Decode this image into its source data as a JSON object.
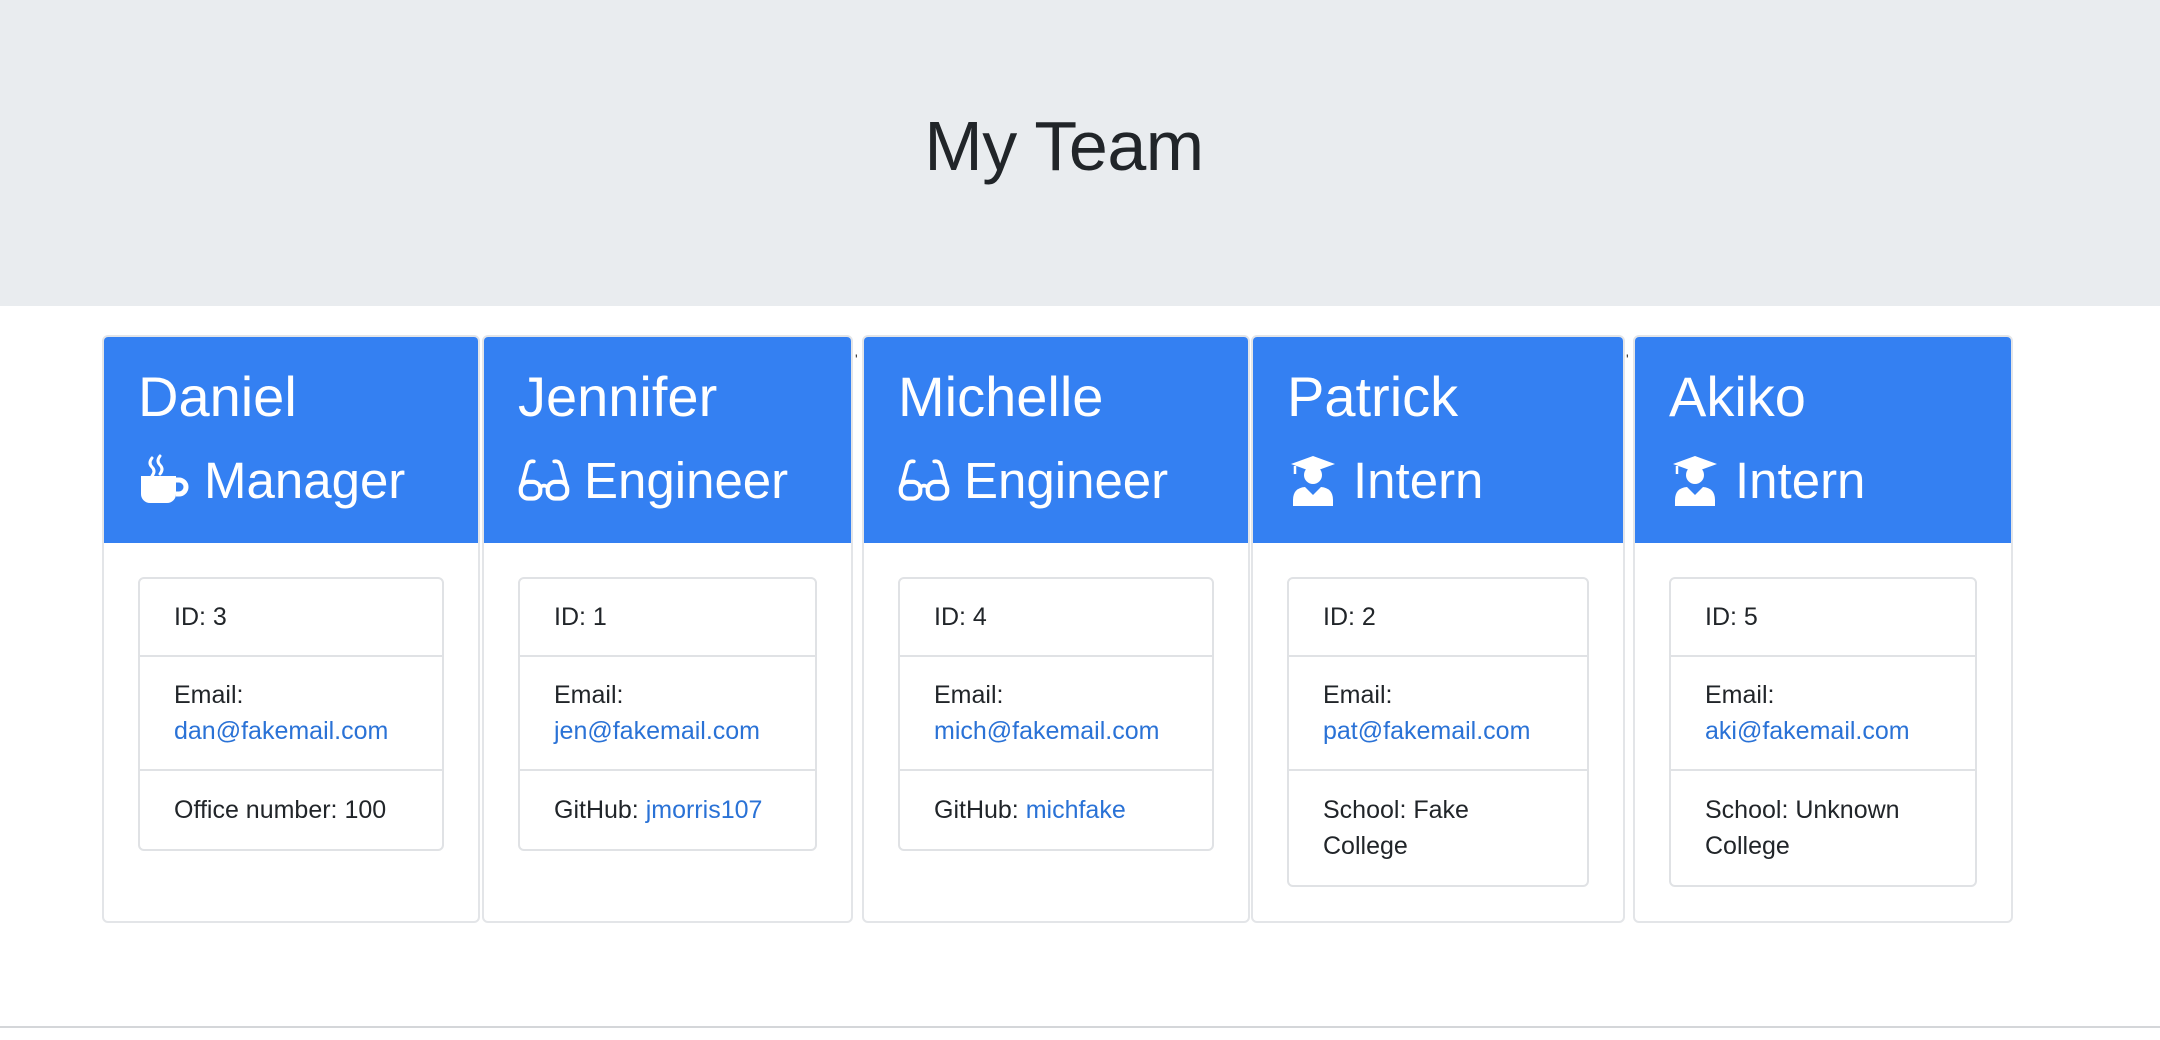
{
  "header": {
    "title": "My Team"
  },
  "team": [
    {
      "name": "Daniel",
      "role": "Manager",
      "role_icon": "mug-icon",
      "id_text": "ID: 3",
      "email_label": "Email:",
      "email": "dan@fakemail.com",
      "extra_label": "Office number: 100",
      "extra_value": ""
    },
    {
      "name": "Jennifer",
      "role": "Engineer",
      "role_icon": "glasses-icon",
      "id_text": "ID: 1",
      "email_label": "Email:",
      "email": "jen@fakemail.com",
      "extra_label": "GitHub: ",
      "extra_value": "jmorris107"
    },
    {
      "name": "Michelle",
      "role": "Engineer",
      "role_icon": "glasses-icon",
      "id_text": "ID: 4",
      "email_label": "Email:",
      "email": "mich@fakemail.com",
      "extra_label": "GitHub: ",
      "extra_value": "michfake"
    },
    {
      "name": "Patrick",
      "role": "Intern",
      "role_icon": "graduate-icon",
      "id_text": "ID: 2",
      "email_label": "Email:",
      "email": "pat@fakemail.com",
      "extra_label": "School: Fake",
      "extra_value": "College"
    },
    {
      "name": "Akiko",
      "role": "Intern",
      "role_icon": "graduate-icon",
      "id_text": "ID: 5",
      "email_label": "Email:",
      "email": "aki@fakemail.com",
      "extra_label": "School: Unknown",
      "extra_value": "College"
    }
  ],
  "colors": {
    "header_bg": "#e9ecef",
    "card_header": "#3480f2",
    "link": "#2a72d6"
  }
}
